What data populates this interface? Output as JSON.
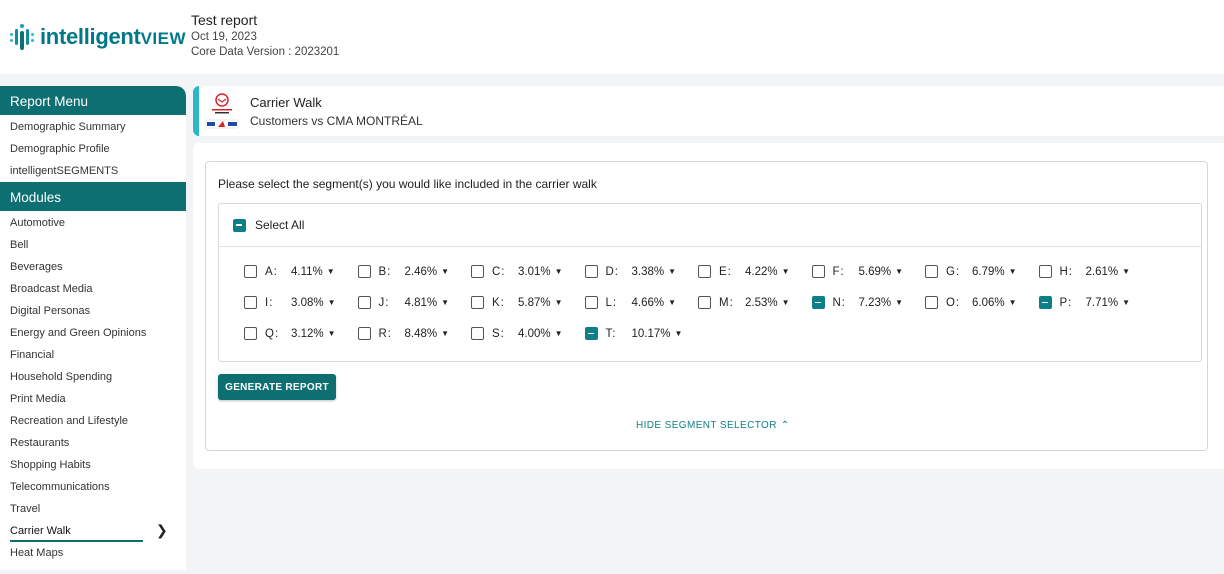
{
  "brand": {
    "name_prefix": "intelligent",
    "name_suffix": "VIEW",
    "color": "#00788a"
  },
  "report": {
    "title": "Test report",
    "date": "Oct 19, 2023",
    "version": "Core Data Version : 2023201"
  },
  "sidebar": {
    "report_menu_title": "Report Menu",
    "report_items": [
      {
        "label": "Demographic Summary"
      },
      {
        "label": "Demographic Profile"
      },
      {
        "label": "intelligentSEGMENTS"
      }
    ],
    "modules_title": "Modules",
    "module_items": [
      {
        "label": "Automotive"
      },
      {
        "label": "Bell"
      },
      {
        "label": "Beverages"
      },
      {
        "label": "Broadcast Media"
      },
      {
        "label": "Digital Personas"
      },
      {
        "label": "Energy and Green Opinions"
      },
      {
        "label": "Financial"
      },
      {
        "label": "Household Spending"
      },
      {
        "label": "Print Media"
      },
      {
        "label": "Recreation and Lifestyle"
      },
      {
        "label": "Restaurants"
      },
      {
        "label": "Shopping Habits"
      },
      {
        "label": "Telecommunications"
      },
      {
        "label": "Travel"
      },
      {
        "label": "Carrier Walk",
        "active": true
      },
      {
        "label": "Heat Maps"
      }
    ],
    "accent": "#0e6f73"
  },
  "page": {
    "title": "Carrier Walk",
    "subtitle": "Customers vs CMA MONTRÉAL"
  },
  "selector": {
    "instructions": "Please select the segment(s) you would like included in the carrier walk",
    "select_all_label": "Select All",
    "select_all_checked": true,
    "segments": [
      {
        "letter": "A:",
        "pct": "4.11%",
        "checked": false
      },
      {
        "letter": "B:",
        "pct": "2.46%",
        "checked": false
      },
      {
        "letter": "C:",
        "pct": "3.01%",
        "checked": false
      },
      {
        "letter": "D:",
        "pct": "3.38%",
        "checked": false
      },
      {
        "letter": "E:",
        "pct": "4.22%",
        "checked": false
      },
      {
        "letter": "F:",
        "pct": "5.69%",
        "checked": false
      },
      {
        "letter": "G:",
        "pct": "6.79%",
        "checked": false
      },
      {
        "letter": "H:",
        "pct": "2.61%",
        "checked": false
      },
      {
        "letter": "I:",
        "pct": "3.08%",
        "checked": false
      },
      {
        "letter": "J:",
        "pct": "4.81%",
        "checked": false
      },
      {
        "letter": "K:",
        "pct": "5.87%",
        "checked": false
      },
      {
        "letter": "L:",
        "pct": "4.66%",
        "checked": false
      },
      {
        "letter": "M:",
        "pct": "2.53%",
        "checked": false
      },
      {
        "letter": "N:",
        "pct": "7.23%",
        "checked": true
      },
      {
        "letter": "O:",
        "pct": "6.06%",
        "checked": false
      },
      {
        "letter": "P:",
        "pct": "7.71%",
        "checked": true
      },
      {
        "letter": "Q:",
        "pct": "3.12%",
        "checked": false
      },
      {
        "letter": "R:",
        "pct": "8.48%",
        "checked": false
      },
      {
        "letter": "S:",
        "pct": "4.00%",
        "checked": false
      },
      {
        "letter": "T:",
        "pct": "10.17%",
        "checked": true
      }
    ],
    "generate_label": "GENERATE REPORT",
    "hide_label": "HIDE SEGMENT SELECTOR",
    "accent": "#0e7f86"
  }
}
